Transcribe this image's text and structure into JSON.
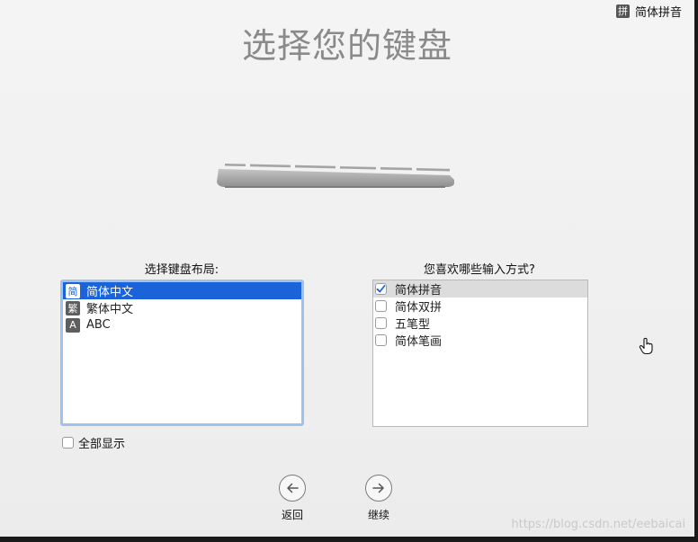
{
  "input_menu": {
    "badge": "拼",
    "label": "简体拼音"
  },
  "title": "选择您的键盘",
  "layouts": {
    "label": "选择键盘布局:",
    "items": [
      {
        "glyph": "简",
        "label": "简体中文",
        "selected": true
      },
      {
        "glyph": "繁",
        "label": "繁体中文",
        "selected": false
      },
      {
        "glyph": "A",
        "label": "ABC",
        "selected": false
      }
    ]
  },
  "methods": {
    "label": "您喜欢哪些输入方式?",
    "items": [
      {
        "label": "简体拼音",
        "checked": true
      },
      {
        "label": "简体双拼",
        "checked": false
      },
      {
        "label": "五笔型",
        "checked": false
      },
      {
        "label": "简体笔画",
        "checked": false
      }
    ]
  },
  "show_all": {
    "label": "全部显示",
    "checked": false
  },
  "nav": {
    "back_label": "返回",
    "continue_label": "继续"
  },
  "watermark": "https://blog.csdn.net/eebaicai",
  "colors": {
    "selection": "#1a63d8",
    "title": "#8a8a8a",
    "focus_ring": "#9ec1ee"
  }
}
